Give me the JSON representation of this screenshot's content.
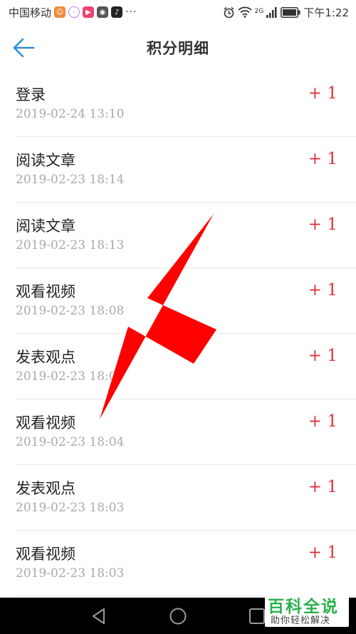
{
  "status_bar": {
    "carrier": "中国移动",
    "overflow": "···",
    "network": "2G",
    "time": "下午1:22"
  },
  "header": {
    "title": "积分明细"
  },
  "records": [
    {
      "title": "登录",
      "time": "2019-02-24  13:10",
      "points": "+ 1"
    },
    {
      "title": "阅读文章",
      "time": "2019-02-23  18:14",
      "points": "+ 1"
    },
    {
      "title": "阅读文章",
      "time": "2019-02-23  18:13",
      "points": "+ 1"
    },
    {
      "title": "观看视频",
      "time": "2019-02-23  18:08",
      "points": "+ 1"
    },
    {
      "title": "发表观点",
      "time": "2019-02-23  18:07",
      "points": "+ 1"
    },
    {
      "title": "观看视频",
      "time": "2019-02-23  18:04",
      "points": "+ 1"
    },
    {
      "title": "发表观点",
      "time": "2019-02-23  18:03",
      "points": "+ 1"
    },
    {
      "title": "观看视频",
      "time": "2019-02-23  18:03",
      "points": "+ 1"
    }
  ],
  "watermark": {
    "main": "百科全说",
    "sub": "助你轻松解决"
  },
  "colors": {
    "accent": "#2f8fd6",
    "points": "#d9343a",
    "annotation": "#ff0000",
    "watermark": "#2bb24c"
  },
  "icons": [
    "back-arrow-icon",
    "alarm-icon",
    "wifi-icon",
    "signal-icon",
    "battery-icon",
    "nav-back-icon",
    "nav-home-icon",
    "nav-recent-icon"
  ]
}
